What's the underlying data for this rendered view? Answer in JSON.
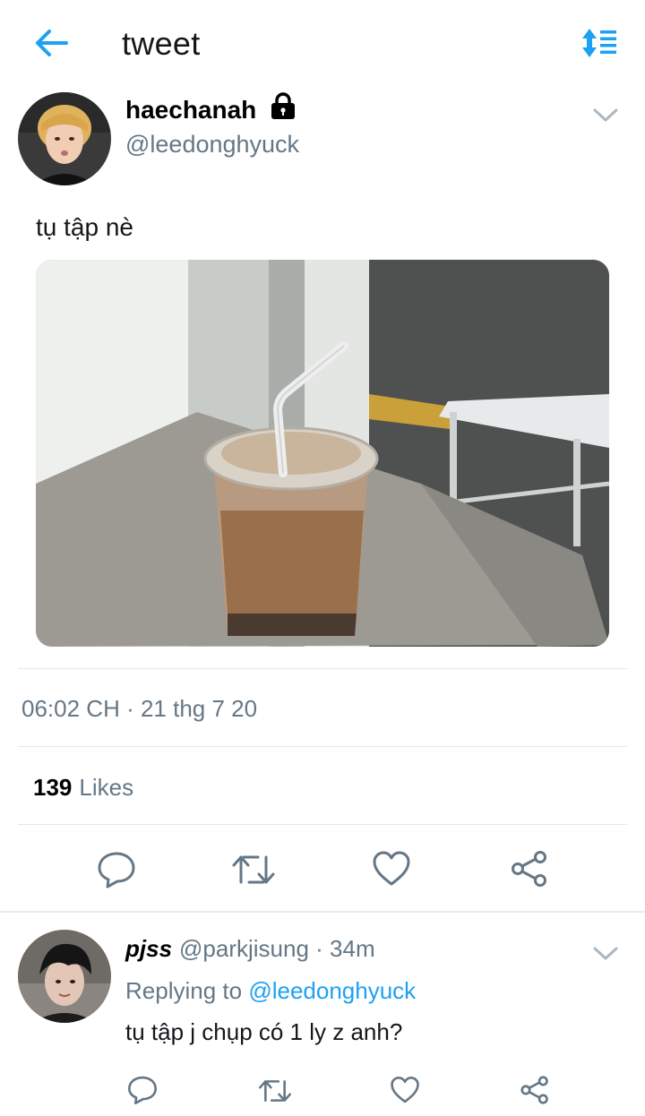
{
  "header": {
    "title": "tweet"
  },
  "tweet": {
    "display_name": "haechanah",
    "username": "@leedonghyuck",
    "text": "tụ tập nè",
    "timestamp": "06:02 CH · 21 thg 7 20",
    "likes_count": "139",
    "likes_label": "Likes",
    "photo_alt": "iced coffee cup with straw on table by window"
  },
  "reply": {
    "display_name": "pjss",
    "username": "@parkjisung",
    "time": "· 34m",
    "replying_label": "Replying to",
    "replying_to": "@leedonghyuck",
    "text": "tụ tập j chụp có 1 ly z anh?"
  },
  "colors": {
    "accent": "#1da1f2",
    "muted": "#657786",
    "divider": "#e1e8ed"
  },
  "icons": [
    "back-arrow-icon",
    "sort-icon",
    "lock-icon",
    "chevron-down-icon",
    "reply-icon",
    "retweet-icon",
    "like-icon",
    "share-icon"
  ]
}
